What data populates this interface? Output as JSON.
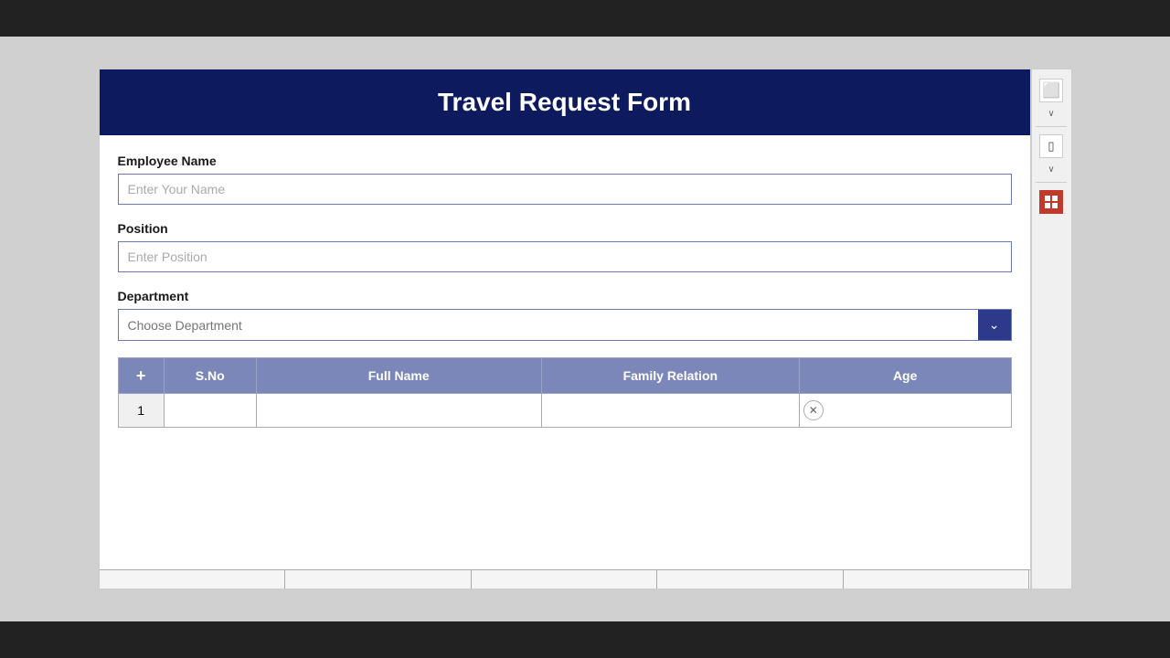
{
  "page": {
    "title": "Travel Request Form",
    "background_top_bar": "#222222",
    "background_bottom_bar": "#222222"
  },
  "header": {
    "title": "Travel Request Form"
  },
  "fields": {
    "employee_name": {
      "label": "Employee Name",
      "placeholder": "Enter Your Name",
      "value": ""
    },
    "position": {
      "label": "Position",
      "placeholder": "Enter Position",
      "value": ""
    },
    "department": {
      "label": "Department",
      "placeholder": "Choose Department",
      "value": ""
    }
  },
  "table": {
    "add_button_label": "+",
    "columns": {
      "sno": "S.No",
      "fullname": "Full Name",
      "relation": "Family Relation",
      "age": "Age"
    },
    "rows": [
      {
        "sno": "1",
        "fullname": "",
        "relation": "",
        "age": ""
      }
    ]
  },
  "side_panel": {
    "icons": [
      {
        "name": "monitor-icon",
        "symbol": "⬜"
      },
      {
        "name": "chevron-down-icon-1",
        "symbol": "∨"
      },
      {
        "name": "mobile-icon",
        "symbol": "📱"
      },
      {
        "name": "chevron-down-icon-2",
        "symbol": "∨"
      },
      {
        "name": "grid-icon",
        "symbol": "▦"
      }
    ]
  }
}
